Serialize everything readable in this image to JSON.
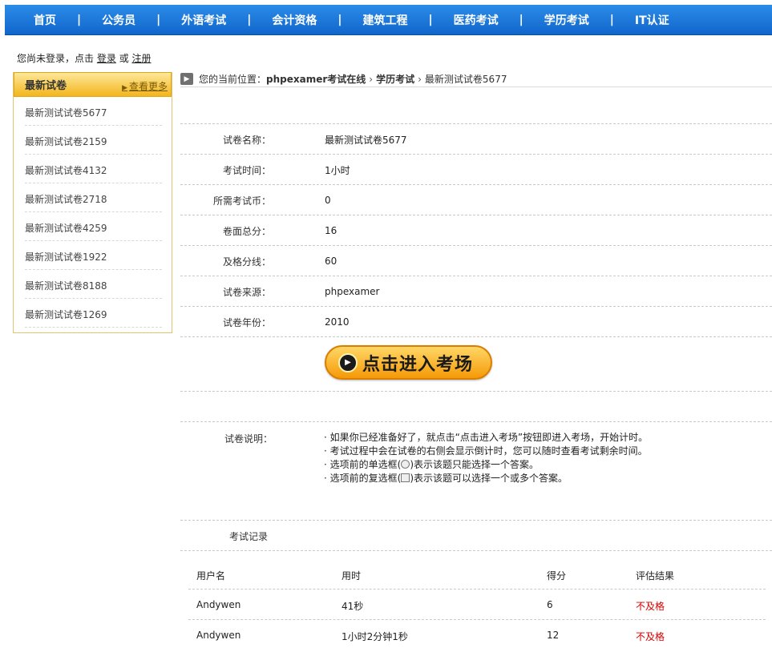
{
  "nav": {
    "items": [
      "首页",
      "公务员",
      "外语考试",
      "会计资格",
      "建筑工程",
      "医药考试",
      "学历考试",
      "IT认证"
    ],
    "separator": "|"
  },
  "login": {
    "prefix": "您尚未登录，点击",
    "login_link": "登录",
    "or": "或",
    "register_link": "注册"
  },
  "sidebar": {
    "title": "最新试卷",
    "more": "查看更多",
    "items": [
      "最新测试试卷5677",
      "最新测试试卷2159",
      "最新测试试卷4132",
      "最新测试试卷2718",
      "最新测试试卷4259",
      "最新测试试卷1922",
      "最新测试试卷8188",
      "最新测试试卷1269"
    ]
  },
  "breadcrumb": {
    "prefix": "您的当前位置：",
    "site": "phpexamer考试在线",
    "category": "学历考试",
    "current": "最新测试试卷5677"
  },
  "exam": {
    "name_label": "试卷名称：",
    "name": "最新测试试卷5677",
    "time_label": "考试时间：",
    "time": "1小时",
    "coins_label": "所需考试币：",
    "coins": "0",
    "total_label": "卷面总分：",
    "total": "16",
    "pass_label": "及格分线：",
    "pass": "60",
    "source_label": "试卷来源：",
    "source": "phpexamer",
    "year_label": "试卷年份：",
    "year": "2010"
  },
  "enter_button": "点击进入考场",
  "notes": {
    "label": "试卷说明：",
    "line1": "如果你已经准备好了，就点击“点击进入考场”按钮即进入考场，开始计时。",
    "line2": "考试过程中会在试卷的右侧会显示倒计时，您可以随时查看考试剩余时间。",
    "line3a": "选项前的单选框(",
    "line3b": ")表示该题只能选择一个答案。",
    "line4a": "选项前的复选框(",
    "line4b": ")表示该题可以选择一个或多个答案。"
  },
  "records": {
    "title": "考试记录",
    "headers": [
      "用户名",
      "用时",
      "得分",
      "评估结果"
    ],
    "rows": [
      [
        "Andywen",
        "41秒",
        "6",
        "不及格"
      ],
      [
        "Andywen",
        "1小时2分钟1秒",
        "12",
        "不及格"
      ]
    ]
  },
  "colors": {
    "nav_bg": "#1a78dc",
    "sidebar_header": "#f5c23a",
    "fail_text": "#d40000",
    "button": "#f7a91a"
  }
}
